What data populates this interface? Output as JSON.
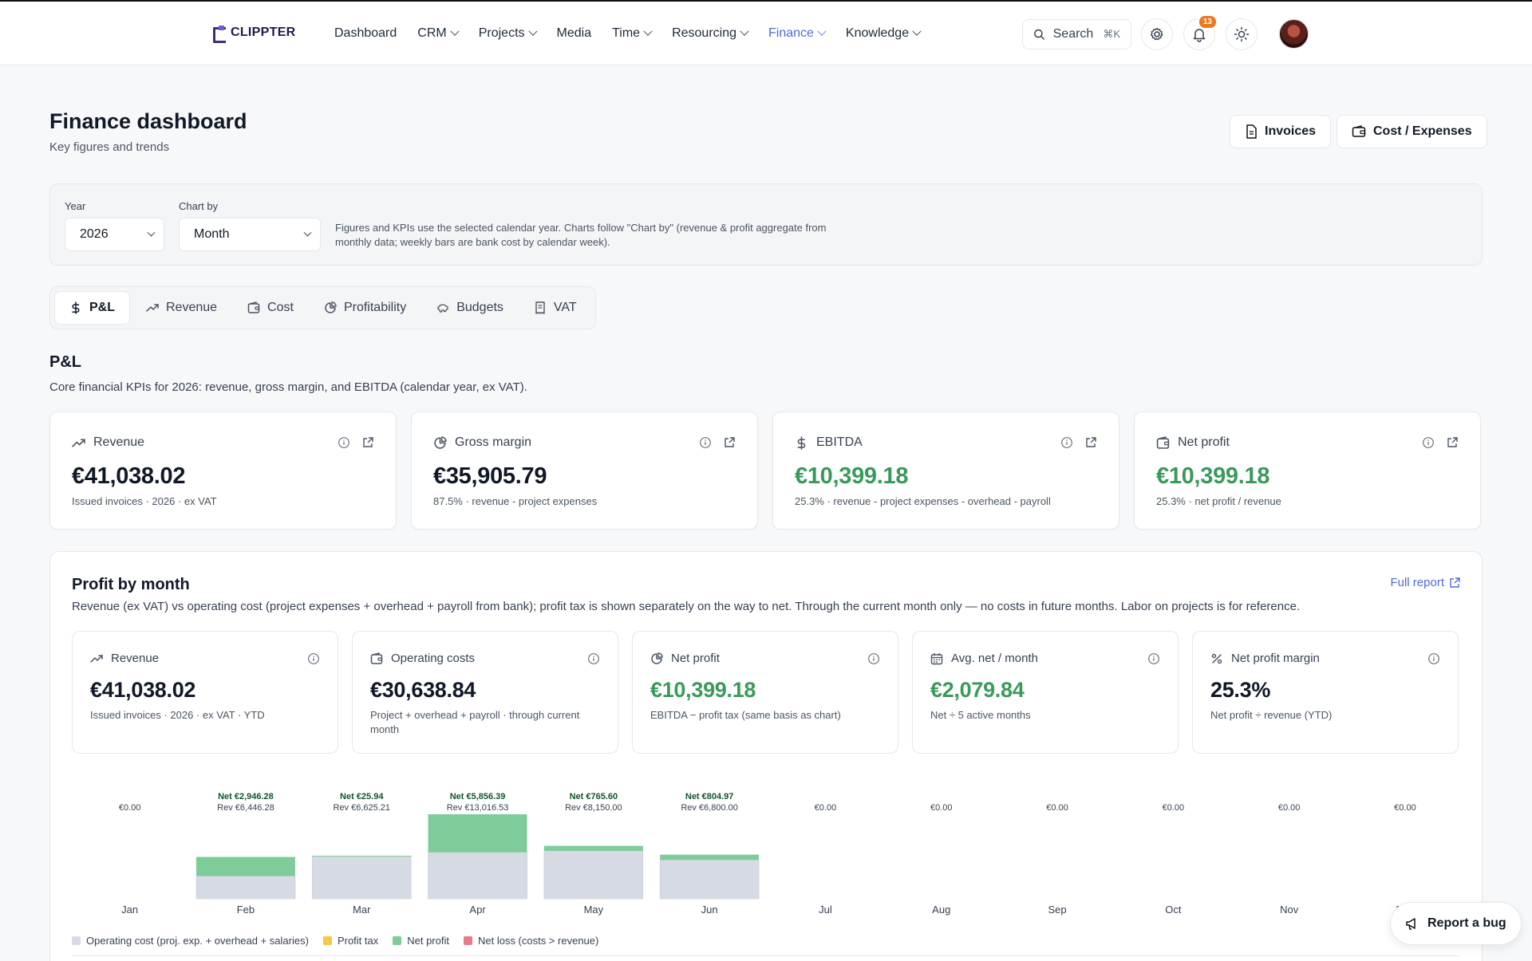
{
  "app": {
    "logo_text": "CLIPPTER"
  },
  "nav": [
    {
      "label": "Dashboard",
      "dropdown": false,
      "active": false
    },
    {
      "label": "CRM",
      "dropdown": true,
      "active": false
    },
    {
      "label": "Projects",
      "dropdown": true,
      "active": false
    },
    {
      "label": "Media",
      "dropdown": false,
      "active": false
    },
    {
      "label": "Time",
      "dropdown": true,
      "active": false
    },
    {
      "label": "Resourcing",
      "dropdown": true,
      "active": false
    },
    {
      "label": "Finance",
      "dropdown": true,
      "active": true
    },
    {
      "label": "Knowledge",
      "dropdown": true,
      "active": false
    }
  ],
  "search": {
    "label": "Search",
    "shortcut": "⌘K"
  },
  "notifications": {
    "count": "13"
  },
  "colors": {
    "accent": "#4f6bd8",
    "positive": "#3a9a5b",
    "badge": "#ea7a1f",
    "operating_cost": "#d6dbe3",
    "net_profit": "#7dcc9a",
    "profit_tax": "#f3c84b",
    "net_loss": "#e87a8a"
  },
  "header": {
    "title": "Finance dashboard",
    "subtitle": "Key figures and trends",
    "invoices_label": "Invoices",
    "costs_label": "Cost / Expenses"
  },
  "filters": {
    "year_label": "Year",
    "year_value": "2026",
    "chartby_label": "Chart by",
    "chartby_value": "Month",
    "note": "Figures and KPIs use the selected calendar year. Charts follow \"Chart by\" (revenue & profit aggregate from monthly data; weekly bars are bank cost by calendar week)."
  },
  "tabs": [
    {
      "label": "P&L",
      "icon": "dollar-icon",
      "active": true
    },
    {
      "label": "Revenue",
      "icon": "trend-icon",
      "active": false
    },
    {
      "label": "Cost",
      "icon": "wallet-icon",
      "active": false
    },
    {
      "label": "Profitability",
      "icon": "pie-icon",
      "active": false
    },
    {
      "label": "Budgets",
      "icon": "piggy-icon",
      "active": false
    },
    {
      "label": "VAT",
      "icon": "receipt-icon",
      "active": false
    }
  ],
  "section": {
    "title": "P&L",
    "subtitle": "Core financial KPIs for 2026: revenue, gross margin, and EBITDA (calendar year, ex VAT)."
  },
  "kpis": [
    {
      "label": "Revenue",
      "icon": "trend-icon",
      "value": "€41,038.02",
      "note": "Issued invoices · 2026 · ex VAT",
      "positive": false
    },
    {
      "label": "Gross margin",
      "icon": "pie-icon",
      "value": "€35,905.79",
      "note": "87.5% · revenue - project expenses",
      "positive": false
    },
    {
      "label": "EBITDA",
      "icon": "dollar-icon",
      "value": "€10,399.18",
      "note": "25.3% · revenue - project expenses - overhead - payroll",
      "positive": true
    },
    {
      "label": "Net profit",
      "icon": "wallet-icon",
      "value": "€10,399.18",
      "note": "25.3% · net profit / revenue",
      "positive": true
    }
  ],
  "profit_panel": {
    "title": "Profit by month",
    "full_report": "Full report",
    "subtitle": "Revenue (ex VAT) vs operating cost (project expenses + overhead + payroll from bank); profit tax is shown separately on the way to net. Through the current month only — no costs in future months. Labor on projects is for reference.",
    "cards": [
      {
        "label": "Revenue",
        "icon": "trend-icon",
        "value": "€41,038.02",
        "note": "Issued invoices · 2026 · ex VAT · YTD",
        "positive": false
      },
      {
        "label": "Operating costs",
        "icon": "wallet-icon",
        "value": "€30,638.84",
        "note": "Project + overhead + payroll · through current month",
        "positive": false
      },
      {
        "label": "Net profit",
        "icon": "pie-icon",
        "value": "€10,399.18",
        "note": "EBITDA − profit tax (same basis as chart)",
        "positive": true
      },
      {
        "label": "Avg. net / month",
        "icon": "calendar-icon",
        "value": "€2,079.84",
        "note": "Net ÷ 5 active months",
        "positive": true
      },
      {
        "label": "Net profit margin",
        "icon": "percent-icon",
        "value": "25.3%",
        "note": "Net profit ÷ revenue (YTD)",
        "positive": false
      }
    ],
    "legend": [
      {
        "label": "Operating cost (proj. exp. + overhead + salaries)",
        "color": "#d6dbe3"
      },
      {
        "label": "Profit tax",
        "color": "#f3c84b"
      },
      {
        "label": "Net profit",
        "color": "#7dcc9a"
      },
      {
        "label": "Net loss (costs > revenue)",
        "color": "#e87a8a"
      }
    ]
  },
  "chart_data": {
    "type": "bar",
    "stacked": true,
    "categories": [
      "Jan",
      "Feb",
      "Mar",
      "Apr",
      "May",
      "Jun",
      "Jul",
      "Aug",
      "Sep",
      "Oct",
      "Nov",
      "Dec"
    ],
    "series": [
      {
        "name": "Operating cost (proj. exp. + overhead + salaries)",
        "values": [
          0,
          3500.0,
          6599.27,
          7160.14,
          7384.4,
          5995.03,
          0,
          0,
          0,
          0,
          0,
          0
        ]
      },
      {
        "name": "Net profit",
        "values": [
          0,
          2946.28,
          25.94,
          5856.39,
          765.6,
          804.97,
          0,
          0,
          0,
          0,
          0,
          0
        ]
      }
    ],
    "revenue": [
      0,
      6446.28,
      6625.21,
      13016.53,
      8150.0,
      6800.0,
      0,
      0,
      0,
      0,
      0,
      0
    ],
    "labels": [
      {
        "net": "",
        "rev": "€0.00"
      },
      {
        "net": "Net €2,946.28",
        "rev": "Rev €6,446.28"
      },
      {
        "net": "Net €25.94",
        "rev": "Rev €6,625.21"
      },
      {
        "net": "Net €5,856.39",
        "rev": "Rev €13,016.53"
      },
      {
        "net": "Net €765.60",
        "rev": "Rev €8,150.00"
      },
      {
        "net": "Net €804.97",
        "rev": "Rev €6,800.00"
      },
      {
        "net": "",
        "rev": "€0.00"
      },
      {
        "net": "",
        "rev": "€0.00"
      },
      {
        "net": "",
        "rev": "€0.00"
      },
      {
        "net": "",
        "rev": "€0.00"
      },
      {
        "net": "",
        "rev": "€0.00"
      },
      {
        "net": "",
        "rev": "€0.00"
      }
    ],
    "ylim": [
      0,
      13016.53
    ],
    "grid": false,
    "legend_position": "bottom-left"
  },
  "report_bug": "Report a bug"
}
